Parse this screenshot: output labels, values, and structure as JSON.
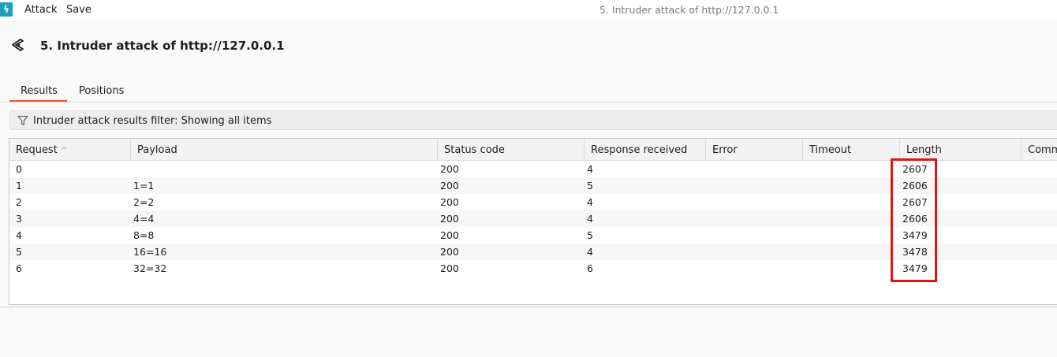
{
  "menubar": {
    "attack_label": "Attack",
    "save_label": "Save",
    "window_title": "5. Intruder attack of http://127.0.0.1"
  },
  "header": {
    "title": "5. Intruder attack of http://127.0.0.1",
    "icon": "intruder-target-icon"
  },
  "tabs": [
    {
      "label": "Results",
      "active": true
    },
    {
      "label": "Positions",
      "active": false
    }
  ],
  "filter": {
    "text": "Intruder attack results filter: Showing all items",
    "icon": "filter-funnel-icon"
  },
  "table": {
    "columns": [
      "Request",
      "Payload",
      "Status code",
      "Response received",
      "Error",
      "Timeout",
      "Length",
      "Comme"
    ],
    "sort_column": "Request",
    "rows": [
      {
        "request": "0",
        "payload": "",
        "status": "200",
        "response": "4",
        "error": "",
        "timeout": "",
        "length": "2607",
        "comment": ""
      },
      {
        "request": "1",
        "payload": "1=1",
        "status": "200",
        "response": "5",
        "error": "",
        "timeout": "",
        "length": "2606",
        "comment": ""
      },
      {
        "request": "2",
        "payload": "2=2",
        "status": "200",
        "response": "4",
        "error": "",
        "timeout": "",
        "length": "2607",
        "comment": ""
      },
      {
        "request": "3",
        "payload": "4=4",
        "status": "200",
        "response": "4",
        "error": "",
        "timeout": "",
        "length": "2606",
        "comment": ""
      },
      {
        "request": "4",
        "payload": "8=8",
        "status": "200",
        "response": "5",
        "error": "",
        "timeout": "",
        "length": "3479",
        "comment": ""
      },
      {
        "request": "5",
        "payload": "16=16",
        "status": "200",
        "response": "4",
        "error": "",
        "timeout": "",
        "length": "3478",
        "comment": ""
      },
      {
        "request": "6",
        "payload": "32=32",
        "status": "200",
        "response": "6",
        "error": "",
        "timeout": "",
        "length": "3479",
        "comment": ""
      }
    ]
  },
  "colors": {
    "accent_tab": "#e8582e",
    "highlight": "#e21414",
    "logo": "#1aa0b8"
  }
}
